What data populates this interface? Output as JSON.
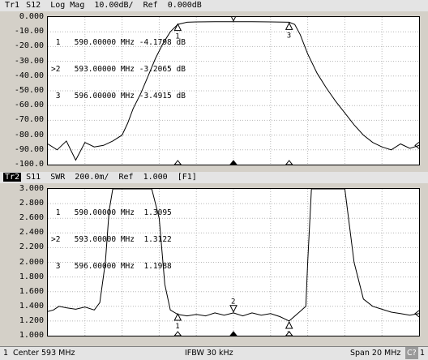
{
  "trace1": {
    "id": "Tr1",
    "header": "S12  Log Mag  10.00dB/  Ref  0.000dB",
    "y_labels": [
      "0.000",
      "-10.00",
      "-20.00",
      "-30.00",
      "-40.00",
      "-50.00",
      "-60.00",
      "-70.00",
      "-80.00",
      "-90.00",
      "-100.0"
    ],
    "markers": [
      {
        "prefix": " ",
        "num": "1",
        "freq": "590.00000 MHz",
        "value": "-4.1798 dB"
      },
      {
        "prefix": ">",
        "num": "2",
        "freq": "593.00000 MHz",
        "value": "-3.2065 dB"
      },
      {
        "prefix": " ",
        "num": "3",
        "freq": "596.00000 MHz",
        "value": "-3.4915 dB"
      }
    ]
  },
  "trace2": {
    "id": "Tr2",
    "header": "S11  SWR  200.0m/  Ref  1.000  [F1]",
    "y_labels": [
      "3.000",
      "2.800",
      "2.600",
      "2.400",
      "2.200",
      "2.000",
      "1.800",
      "1.600",
      "1.400",
      "1.200",
      "1.000"
    ],
    "markers": [
      {
        "prefix": " ",
        "num": "1",
        "freq": "590.00000 MHz",
        "value": "1.3095"
      },
      {
        "prefix": ">",
        "num": "2",
        "freq": "593.00000 MHz",
        "value": "1.3122"
      },
      {
        "prefix": " ",
        "num": "3",
        "freq": "596.00000 MHz",
        "value": "1.1988"
      }
    ]
  },
  "chart_data": [
    {
      "type": "line",
      "xlim": [
        583,
        603
      ],
      "ylim": [
        -100,
        0
      ],
      "series": [
        {
          "x": [
            583,
            583.5,
            584,
            584.5,
            585,
            585.5,
            586,
            586.5,
            587,
            587.3,
            587.6,
            588,
            588.4,
            588.8,
            589.2,
            589.6,
            590,
            590.5,
            591,
            592,
            593,
            594,
            595,
            596,
            596.3,
            596.6,
            597,
            597.5,
            598,
            598.5,
            599,
            599.5,
            600,
            600.5,
            601,
            601.5,
            602,
            602.5,
            603
          ],
          "y": [
            -86,
            -90,
            -84,
            -97,
            -85,
            -88,
            -87,
            -84,
            -80,
            -72,
            -62,
            -52,
            -40,
            -28,
            -18,
            -10,
            -5,
            -3.5,
            -3.3,
            -3.2,
            -3.2,
            -3.2,
            -3.3,
            -3.5,
            -5,
            -12,
            -25,
            -38,
            -48,
            -57,
            -65,
            -73,
            -80,
            -85,
            -88,
            -90,
            -86,
            -89,
            -87
          ]
        }
      ],
      "markers": [
        {
          "x": 590,
          "y": -4.1798
        },
        {
          "x": 593,
          "y": -3.2065
        },
        {
          "x": 596,
          "y": -3.4915
        }
      ]
    },
    {
      "type": "line",
      "xlim": [
        583,
        603
      ],
      "ylim": [
        1.0,
        3.0
      ],
      "series": [
        {
          "x": [
            583,
            583.3,
            583.6,
            584,
            584.5,
            585,
            585.5,
            585.8,
            586.1,
            586.3,
            586.5,
            587,
            588,
            588.6,
            589,
            589.3,
            589.6,
            590,
            590.5,
            591,
            591.5,
            592,
            592.5,
            593,
            593.5,
            594,
            594.5,
            595,
            595.5,
            596,
            596.5,
            596.9,
            597,
            597.2,
            597.4,
            597.6,
            597.9,
            598.5,
            599,
            599.5,
            600,
            600.5,
            601,
            601.5,
            602,
            602.5,
            603
          ],
          "y": [
            1.33,
            1.35,
            1.4,
            1.38,
            1.36,
            1.39,
            1.35,
            1.45,
            2.0,
            2.7,
            3.0,
            3.0,
            3.0,
            3.0,
            2.6,
            1.7,
            1.35,
            1.29,
            1.27,
            1.29,
            1.27,
            1.31,
            1.28,
            1.31,
            1.27,
            1.31,
            1.28,
            1.3,
            1.26,
            1.2,
            1.31,
            1.4,
            2.0,
            3.0,
            3.0,
            3.0,
            3.0,
            3.0,
            3.0,
            2.0,
            1.5,
            1.4,
            1.36,
            1.32,
            1.3,
            1.28,
            1.3
          ]
        }
      ],
      "markers": [
        {
          "x": 590,
          "y": 1.3095
        },
        {
          "x": 593,
          "y": 1.3122
        },
        {
          "x": 596,
          "y": 1.1988
        }
      ]
    }
  ],
  "status": {
    "channel": "1",
    "center": "Center 593 MHz",
    "ifbw": "IFBW 30 kHz",
    "span": "Span 20 MHz",
    "cal": "C?",
    "end": "1"
  }
}
